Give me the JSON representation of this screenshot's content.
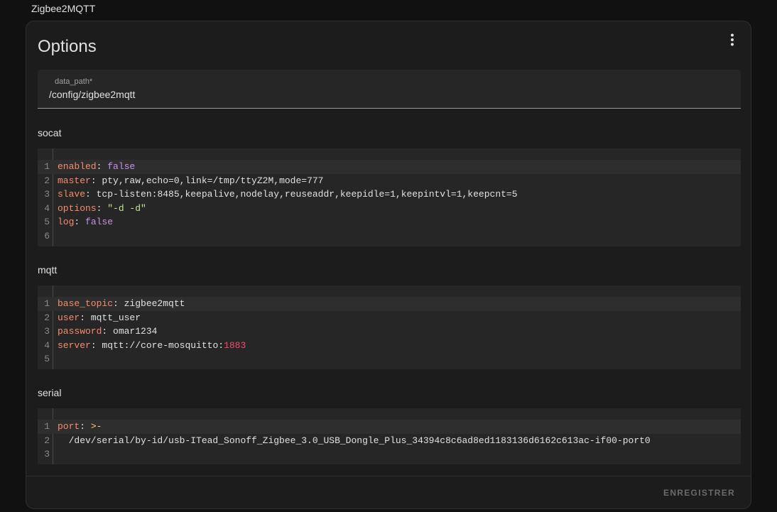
{
  "addon": {
    "title": "Zigbee2MQTT"
  },
  "card": {
    "title": "Options",
    "menu_icon": "dots-vertical-icon"
  },
  "data_path": {
    "label": "data_path*",
    "value": "/config/zigbee2mqtt"
  },
  "sections": {
    "socat": {
      "label": "socat",
      "lines": [
        {
          "n": "1",
          "key": "enabled",
          "sep": ": ",
          "value": "false",
          "vtype": "b"
        },
        {
          "n": "2",
          "key": "master",
          "sep": ": ",
          "value": "pty,raw,echo=0,link=/tmp/ttyZ2M,mode=777",
          "vtype": "p"
        },
        {
          "n": "3",
          "key": "slave",
          "sep": ": ",
          "value": "tcp-listen:8485,keepalive,nodelay,reuseaddr,keepidle=1,keepintvl=1,keepcnt=5",
          "vtype": "p"
        },
        {
          "n": "4",
          "key": "options",
          "sep": ": ",
          "value": "\"-d -d\"",
          "vtype": "s"
        },
        {
          "n": "5",
          "key": "log",
          "sep": ": ",
          "value": "false",
          "vtype": "b"
        },
        {
          "n": "6",
          "key": "",
          "sep": "",
          "value": "",
          "vtype": "p"
        }
      ]
    },
    "mqtt": {
      "label": "mqtt",
      "lines": [
        {
          "n": "1",
          "key": "base_topic",
          "sep": ": ",
          "value": "zigbee2mqtt",
          "vtype": "p"
        },
        {
          "n": "2",
          "key": "user",
          "sep": ": ",
          "value": "mqtt_user",
          "vtype": "p"
        },
        {
          "n": "3",
          "key": "password",
          "sep": ": ",
          "value": "omar1234",
          "vtype": "p"
        },
        {
          "n": "4",
          "key": "server",
          "sep": ": ",
          "value": "mqtt://core-mosquitto:",
          "vtype": "p",
          "extra": "1883",
          "etype": "n"
        },
        {
          "n": "5",
          "key": "",
          "sep": "",
          "value": "",
          "vtype": "p"
        }
      ]
    },
    "serial": {
      "label": "serial",
      "lines": [
        {
          "n": "1",
          "key": "port",
          "sep": ": ",
          "value": ">-",
          "vtype": "o"
        },
        {
          "n": "2",
          "key": "",
          "sep": "",
          "value": "  /dev/serial/by-id/usb-ITead_Sonoff_Zigbee_3.0_USB_Dongle_Plus_34394c8c6ad8ed1183136d6162c613ac-if00-port0",
          "vtype": "p"
        },
        {
          "n": "3",
          "key": "",
          "sep": "",
          "value": "",
          "vtype": "p"
        }
      ]
    }
  },
  "footer": {
    "save_label": "ENREGISTRER"
  }
}
